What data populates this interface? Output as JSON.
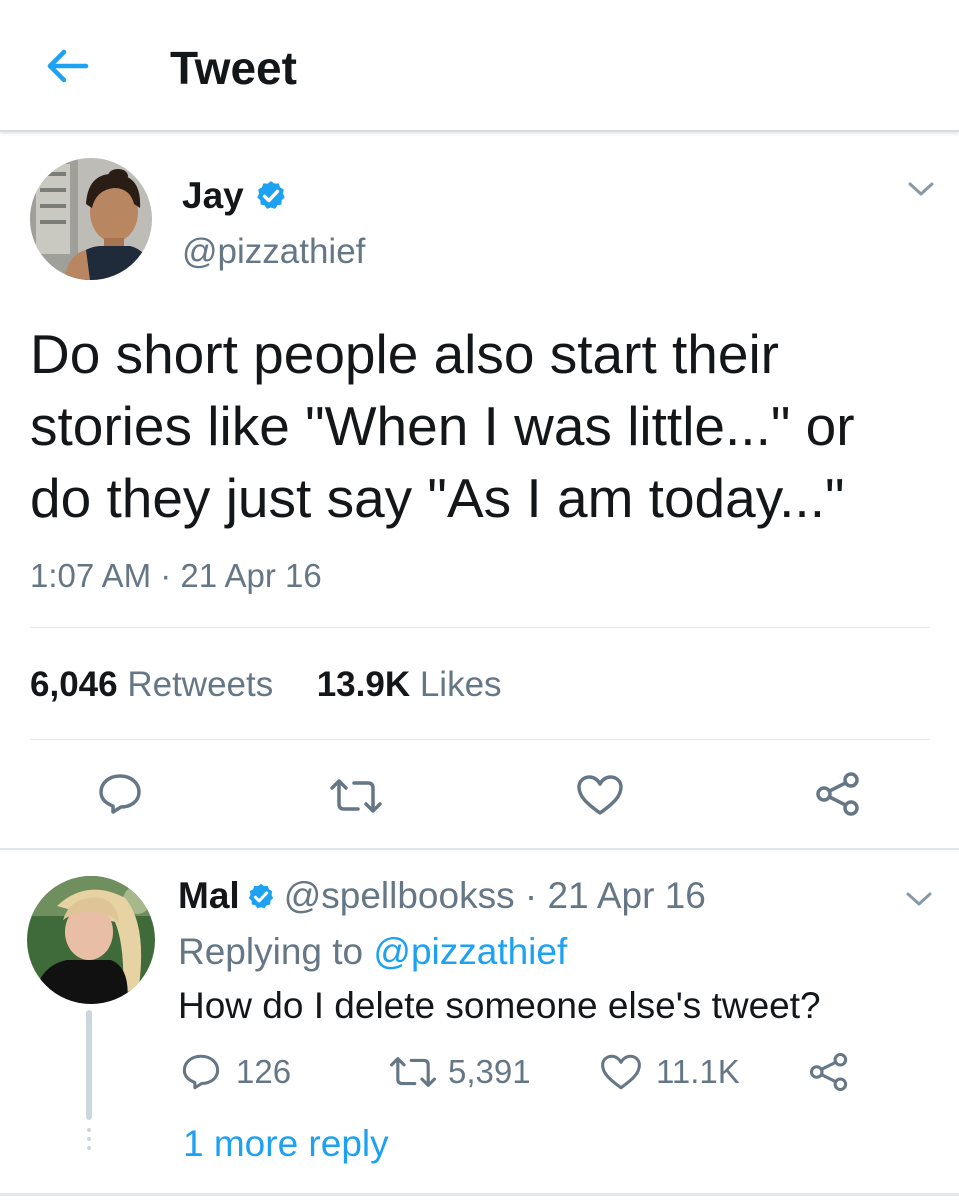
{
  "header": {
    "back_icon": "arrow-left-icon",
    "title": "Tweet"
  },
  "tweet": {
    "author": {
      "name": "Jay",
      "handle": "@pizzathief",
      "verified": true
    },
    "text": "Do short people also start their\nstories like \"When I was little...\" or\ndo they just say \"As I am today...\"",
    "time": "1:07 AM",
    "separator": " · ",
    "date": "21 Apr 16",
    "stats": {
      "retweets_count": "6,046",
      "retweets_label": "Retweets",
      "likes_count": "13.9K",
      "likes_label": "Likes"
    },
    "actions": [
      "reply-icon",
      "retweet-icon",
      "like-icon",
      "share-icon"
    ]
  },
  "reply": {
    "author": {
      "name": "Mal",
      "handle": "@spellbookss",
      "verified": true
    },
    "separator": " · ",
    "date": "21 Apr 16",
    "replying_prefix": "Replying to ",
    "replying_to": "@pizzathief",
    "text": "How do I delete someone else's tweet?",
    "counts": {
      "replies": "126",
      "retweets": "5,391",
      "likes": "11.1K"
    }
  },
  "more_replies": "1 more reply",
  "colors": {
    "accent": "#1da1f2",
    "text": "#14171a",
    "secondary": "#657786",
    "divider": "#e1e8ed",
    "verified": "#1da1f2"
  }
}
